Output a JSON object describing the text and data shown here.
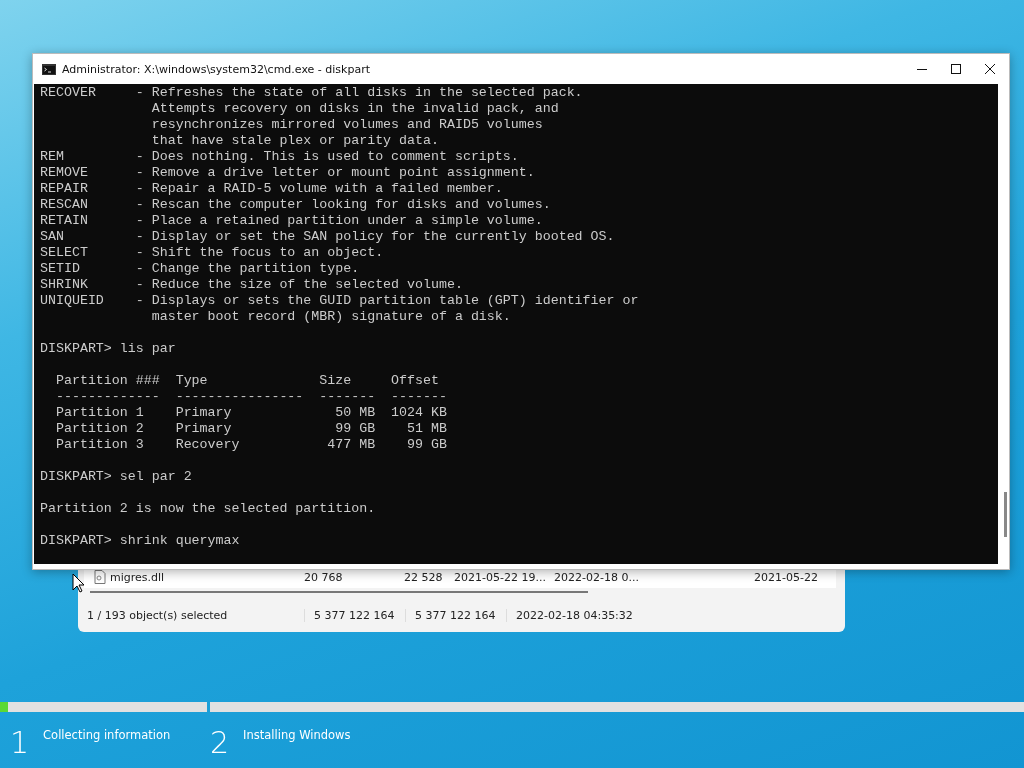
{
  "explorer": {
    "row": {
      "name": "migres.dll",
      "cells": [
        "20 768",
        "22 528",
        "2021-05-22 19...",
        "2022-02-18 0...",
        "2021-05-22"
      ]
    },
    "status_bar": [
      "1 / 193 object(s) selected",
      "5 377 122 164",
      "5 377 122 164",
      "2022-02-18 04:35:32"
    ]
  },
  "console_window": {
    "title": "Administrator: X:\\windows\\system32\\cmd.exe - diskpart",
    "blocks": [
      [
        "RECOVER     - Refreshes the state of all disks in the selected pack.",
        "              Attempts recovery on disks in the invalid pack, and",
        "              resynchronizes mirrored volumes and RAID5 volumes",
        "              that have stale plex or parity data.",
        "REM         - Does nothing. This is used to comment scripts.",
        "REMOVE      - Remove a drive letter or mount point assignment.",
        "REPAIR      - Repair a RAID-5 volume with a failed member.",
        "RESCAN      - Rescan the computer looking for disks and volumes.",
        "RETAIN      - Place a retained partition under a simple volume.",
        "SAN         - Display or set the SAN policy for the currently booted OS.",
        "SELECT      - Shift the focus to an object.",
        "SETID       - Change the partition type.",
        "SHRINK      - Reduce the size of the selected volume.",
        "UNIQUEID    - Displays or sets the GUID partition table (GPT) identifier or",
        "              master boot record (MBR) signature of a disk."
      ],
      [
        "DISKPART> lis par"
      ],
      [
        "  Partition ###  Type              Size     Offset",
        "  -------------  ----------------  -------  -------",
        "  Partition 1    Primary             50 MB  1024 KB",
        "  Partition 2    Primary             99 GB    51 MB",
        "  Partition 3    Recovery           477 MB    99 GB"
      ],
      [
        "DISKPART> sel par 2"
      ],
      [
        "Partition 2 is now the selected partition."
      ],
      [
        "DISKPART> shrink querymax"
      ]
    ]
  },
  "setup_steps": [
    {
      "number": "1",
      "label": "Collecting information",
      "level": 0.04
    },
    {
      "number": "2",
      "label": "Installing Windows",
      "level": 0
    }
  ]
}
